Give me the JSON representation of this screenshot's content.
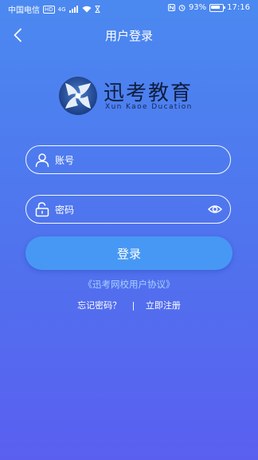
{
  "status_bar": {
    "carrier": "中国电信",
    "hd": "HD",
    "network": "4G",
    "battery": "93%",
    "time": "17:16"
  },
  "nav": {
    "title": "用户登录",
    "back_icon": "chevron-left-icon"
  },
  "brand": {
    "name": "迅考教育",
    "subtitle": "Xun Kaoe Ducation"
  },
  "form": {
    "account_placeholder": "账号",
    "password_placeholder": "密码",
    "account_icon": "user-icon",
    "password_icon": "lock-icon",
    "visibility_icon": "eye-icon",
    "login_label": "登录"
  },
  "footer": {
    "agreement": "《迅考网校用户协议》",
    "forgot_password": "忘记密码？",
    "separator": "|",
    "register": "立即注册"
  },
  "colors": {
    "background_top": "#4b89f0",
    "background_bottom": "#5a5ff0",
    "login_button": "#4798f4",
    "agreement_link": "#a8d0ff"
  }
}
